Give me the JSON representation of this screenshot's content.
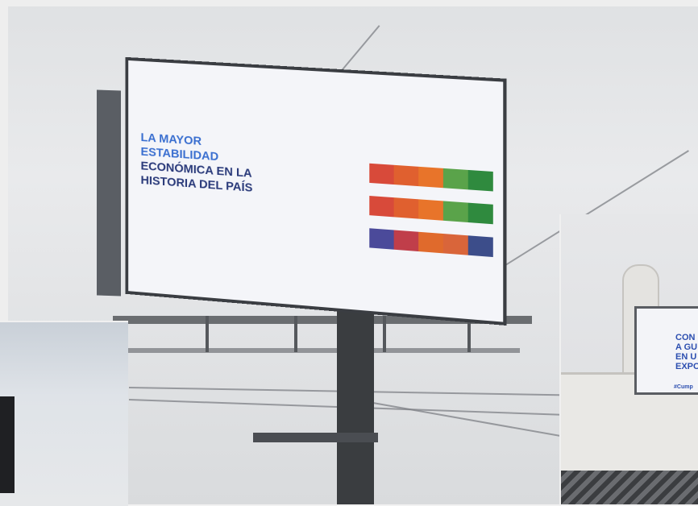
{
  "billboard": {
    "logo": "",
    "slogan": "",
    "headline_lines": [
      "LA MAYOR",
      "ESTABILIDAD",
      "ECONÓMICA EN LA",
      "HISTORIA DEL PAÍS"
    ],
    "hashtag": "",
    "rows": [
      {
        "label": "",
        "colors": [
          "#d84a3a",
          "#e0602f",
          "#e8742a",
          "#5aa34a",
          "#2f8a3e"
        ]
      },
      {
        "label": "",
        "colors": [
          "#d84a3a",
          "#e0602f",
          "#e8742a",
          "#5aa34a",
          "#2f8a3e"
        ]
      },
      {
        "label": "",
        "colors": [
          "#4b4a9a",
          "#c03e4a",
          "#e06a2c",
          "#d9653a",
          "#3c4d8a"
        ]
      }
    ]
  },
  "right_screen": {
    "logo": "",
    "lines": [
      "CON",
      "A GU",
      "EN U",
      "EXPO"
    ],
    "hashtag": "#Cump"
  },
  "colors": {
    "sky": "#e4e6e8",
    "pole": "#3a3d40",
    "billboard_text": "#2a3a7a",
    "accent_blue": "#2d55b5"
  }
}
